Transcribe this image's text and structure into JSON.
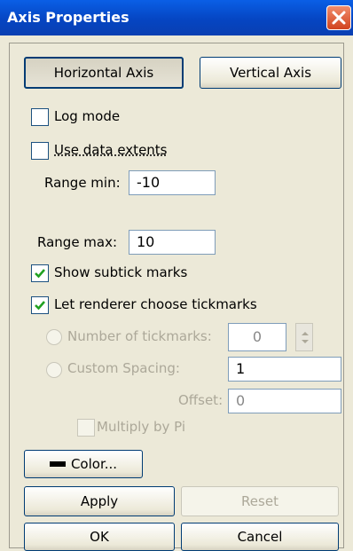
{
  "window": {
    "title": "Axis Properties"
  },
  "tabs": {
    "horizontal": "Horizontal Axis",
    "vertical": "Vertical Axis"
  },
  "options": {
    "log_mode": {
      "label": "Log mode",
      "checked": false
    },
    "use_data_extents": {
      "label": "Use data extents",
      "checked": false
    },
    "range_min": {
      "label": "Range min:",
      "value": "-10"
    },
    "range_max": {
      "label": "Range max:",
      "value": "10"
    },
    "show_subtick": {
      "label": "Show subtick marks",
      "checked": true
    },
    "let_renderer": {
      "label": "Let renderer choose tickmarks",
      "checked": true
    },
    "num_tickmarks": {
      "label": "Number of tickmarks:",
      "value": "0"
    },
    "custom_spacing": {
      "label": "Custom Spacing:",
      "value": "1"
    },
    "offset": {
      "label": "Offset:",
      "value": "0"
    },
    "multiply_pi": {
      "label": "Multiply by Pi",
      "checked": false
    }
  },
  "buttons": {
    "color": "Color...",
    "apply": "Apply",
    "reset": "Reset",
    "ok": "OK",
    "cancel": "Cancel"
  },
  "colors": {
    "title_bar": "#0545c2",
    "close": "#d1431e",
    "face": "#ece9d8"
  }
}
